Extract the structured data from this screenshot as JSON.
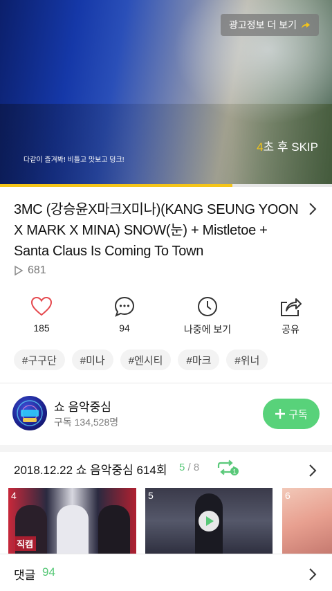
{
  "ad": {
    "info_label": "광고정보 더 보기",
    "subtitle": "다같이 즐겨봐! 비틀고 맛보고 덩크!",
    "skip_countdown": "4",
    "skip_label": "초 후 SKIP",
    "progress_fraction": 0.7
  },
  "video": {
    "title": "3MC (강승윤X마크X미나)(KANG SEUNG YOON X MARK X MINA) SNOW(눈) + Mistletoe + Santa Claus Is Coming To Town",
    "views": "681"
  },
  "actions": [
    {
      "icon": "heart-icon",
      "label": "185"
    },
    {
      "icon": "comment-icon",
      "label": "94"
    },
    {
      "icon": "clock-icon",
      "label": "나중에 보기"
    },
    {
      "icon": "share-icon",
      "label": "공유"
    }
  ],
  "tags": [
    "#구구단",
    "#미나",
    "#엔시티",
    "#마크",
    "#위너"
  ],
  "channel": {
    "name": "쇼 음악중심",
    "subscribers": "구독 134,528명",
    "subscribe_label": "구독",
    "accent": "#58d27a"
  },
  "episode": {
    "title": "2018.12.22 쇼 음악중심 614회",
    "current": "5",
    "total": "/ 8",
    "repeat_badge": "1"
  },
  "thumbnails": [
    {
      "index": "4",
      "caption": "직캠"
    },
    {
      "index": "5"
    },
    {
      "index": "6"
    }
  ],
  "comments": {
    "label": "댓글",
    "count": "94"
  }
}
